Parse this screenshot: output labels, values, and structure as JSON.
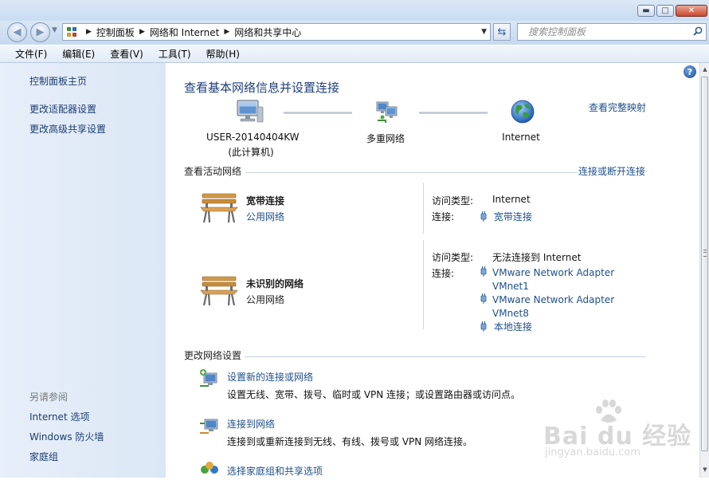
{
  "window": {
    "minimize_glyph": "▬",
    "maximize_glyph": "□",
    "close_glyph": "✕"
  },
  "address_bar": {
    "breadcrumbs": [
      "控制面板",
      "网络和 Internet",
      "网络和共享中心"
    ],
    "search_placeholder": "搜索控制面板"
  },
  "menu": {
    "items": [
      "文件(F)",
      "编辑(E)",
      "查看(V)",
      "工具(T)",
      "帮助(H)"
    ]
  },
  "sidebar": {
    "home": "控制面板主页",
    "links": [
      "更改适配器设置",
      "更改高级共享设置"
    ],
    "see_also_title": "另请参阅",
    "see_also": [
      "Internet 选项",
      "Windows 防火墙",
      "家庭组"
    ]
  },
  "main": {
    "help_glyph": "?",
    "title": "查看基本网络信息并设置连接",
    "full_map_link": "查看完整映射",
    "map": {
      "computer_name": "USER-20140404KW",
      "computer_sub": "(此计算机)",
      "middle": "多重网络",
      "internet": "Internet"
    },
    "active_networks": {
      "title": "查看活动网络",
      "connect_link": "连接或断开连接",
      "networks": [
        {
          "name": "宽带连接",
          "category": "公用网络",
          "access_label": "访问类型:",
          "access_value": "Internet",
          "conn_label": "连接:",
          "connections": [
            "宽带连接"
          ]
        },
        {
          "name": "未识别的网络",
          "category": "公用网络",
          "access_label": "访问类型:",
          "access_value": "无法连接到 Internet",
          "conn_label": "连接:",
          "connections": [
            "VMware Network Adapter VMnet1",
            "VMware Network Adapter VMnet8",
            "本地连接"
          ]
        }
      ]
    },
    "change_settings": {
      "title": "更改网络设置",
      "tasks": [
        {
          "title": "设置新的连接或网络",
          "desc": "设置无线、宽带、拨号、临时或 VPN 连接；或设置路由器或访问点。"
        },
        {
          "title": "连接到网络",
          "desc": "连接到或重新连接到无线、有线、拨号或 VPN 网络连接。"
        },
        {
          "title": "选择家庭组和共享选项",
          "desc": ""
        }
      ]
    }
  },
  "watermark": {
    "text": "Bai du 经验",
    "sub": "jingyan.baidu.com"
  },
  "colors": {
    "link": "#1f4f8e",
    "title": "#1e3f7b",
    "sidebar_bg": "#dfe9f6"
  }
}
